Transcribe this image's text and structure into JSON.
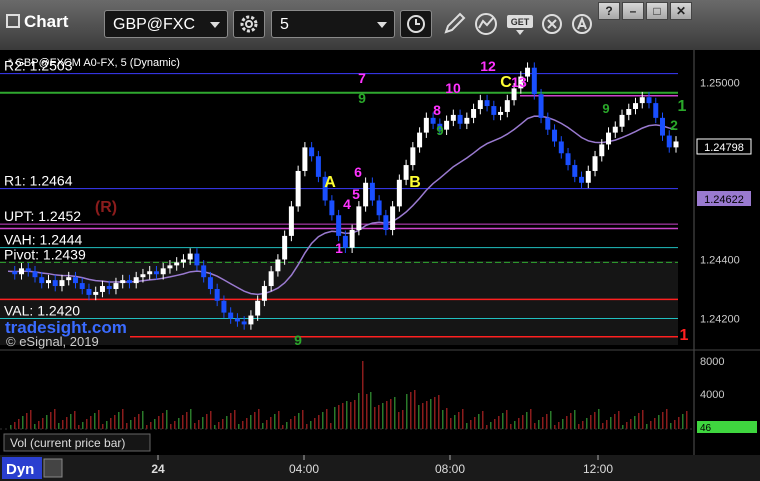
{
  "app": {
    "title": "Chart"
  },
  "toolbar": {
    "symbol": "GBP@FXC",
    "interval": "5",
    "icons": [
      "settings-icon",
      "clock-icon",
      "pencil-icon",
      "study-icon",
      "get-data-icon",
      "close-icon",
      "alert-icon"
    ],
    "window_buttons": [
      "?",
      "–",
      "□",
      "✕"
    ]
  },
  "colors": {
    "background": "#000000",
    "candle_up": "#ffffff",
    "candle_down": "#1a4fff",
    "r2_line": "#3b3bff",
    "green_line": "#2fa82f",
    "magenta_line": "#cc44cc",
    "red_line": "#ff2020",
    "cyan_line": "#20c0c0",
    "ma_line": "#9a7ad0",
    "setup_magenta": "#ff33ff",
    "setup_green": "#2aa82a",
    "label_yellow": "#ffff33",
    "volume_bar": "#8b1c1c",
    "volume_marker": "#3fd63f"
  },
  "chart_data": {
    "type": "candlestick",
    "header": "* GBP@FXCM A0-FX, 5 (Dynamic)",
    "watermark": "tradesight.com",
    "copyright": "© eSignal, 2019",
    "ylim": [
      1.241,
      1.2511
    ],
    "y_ticks": [
      "1.25000",
      "1.24400",
      "1.24200"
    ],
    "x_ticks": [
      "24",
      "04:00",
      "08:00",
      "12:00"
    ],
    "last_price": "1.24798",
    "ma_value": "1.24622",
    "levels": [
      {
        "label": "R2: 1.2503",
        "value": 1.2503
      },
      {
        "label": "R1: 1.2464",
        "value": 1.2464
      },
      {
        "label": "UPT: 1.2452",
        "value": 1.2452
      },
      {
        "label": "VAH: 1.2444",
        "value": 1.2444
      },
      {
        "label": "Pivot: 1.2439",
        "value": 1.2439
      },
      {
        "label": "VAL: 1.2420",
        "value": 1.242
      }
    ],
    "other_lines": [
      {
        "value": 1.24965,
        "color": "green"
      },
      {
        "value": 1.24955,
        "color": "magenta"
      },
      {
        "value": 1.24505,
        "color": "magenta"
      },
      {
        "value": 1.24265,
        "color": "red"
      },
      {
        "value": 1.24138,
        "color": "red"
      }
    ],
    "annotations": [
      "A",
      "B",
      "C",
      "(R)",
      "1",
      "2",
      "1",
      "4",
      "6",
      "5",
      "7",
      "9",
      "8",
      "10",
      "12",
      "13",
      "9",
      "9",
      "9",
      "1"
    ],
    "volume_ticks": [
      "8000",
      "4000"
    ],
    "volume_label": "Vol (current price bar)",
    "volume_last": "46",
    "footer_label": "Dyn",
    "price_path": [
      1.2436,
      1.2435,
      1.2437,
      1.2436,
      1.2434,
      1.2432,
      1.2433,
      1.2431,
      1.2433,
      1.2434,
      1.2432,
      1.243,
      1.2428,
      1.2429,
      1.2431,
      1.243,
      1.2432,
      1.2433,
      1.2432,
      1.2434,
      1.2435,
      1.2436,
      1.2435,
      1.2437,
      1.2438,
      1.2439,
      1.244,
      1.2442,
      1.2438,
      1.2434,
      1.243,
      1.2426,
      1.2422,
      1.242,
      1.2419,
      1.2418,
      1.2421,
      1.2426,
      1.2431,
      1.2436,
      1.244,
      1.2448,
      1.2458,
      1.247,
      1.2478,
      1.2475,
      1.2468,
      1.246,
      1.2455,
      1.2448,
      1.2444,
      1.245,
      1.2458,
      1.2466,
      1.246,
      1.2455,
      1.245,
      1.2458,
      1.2467,
      1.2472,
      1.2478,
      1.2483,
      1.2488,
      1.2486,
      1.2484,
      1.2487,
      1.2489,
      1.2486,
      1.2488,
      1.2491,
      1.2494,
      1.2492,
      1.2489,
      1.249,
      1.2494,
      1.2498,
      1.2502,
      1.2505,
      1.2496,
      1.2488,
      1.2484,
      1.248,
      1.2476,
      1.2472,
      1.2468,
      1.2466,
      1.247,
      1.2475,
      1.2479,
      1.2483,
      1.2485,
      1.2489,
      1.2491,
      1.2493,
      1.2495,
      1.2493,
      1.2488,
      1.2482,
      1.2478,
      1.248
    ]
  }
}
